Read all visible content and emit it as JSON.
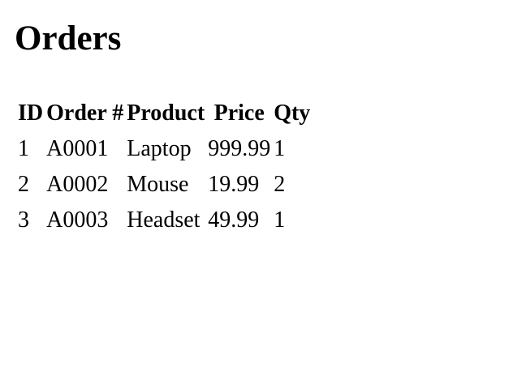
{
  "page": {
    "title": "Orders"
  },
  "table": {
    "headers": [
      "ID",
      "Order #",
      "Product",
      "Price",
      "Qty"
    ],
    "rows": [
      [
        "1",
        "A0001",
        "Laptop",
        "999.99",
        "1"
      ],
      [
        "2",
        "A0002",
        "Mouse",
        "19.99",
        "2"
      ],
      [
        "3",
        "A0003",
        "Headset",
        "49.99",
        "1"
      ]
    ]
  }
}
